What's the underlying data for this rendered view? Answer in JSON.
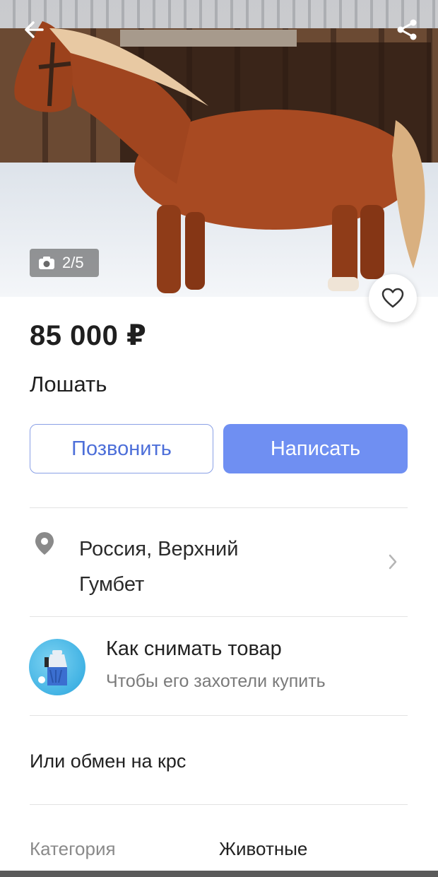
{
  "gallery": {
    "counter": "2/5",
    "icons": {
      "back": "arrow-left-icon",
      "share": "share-icon",
      "camera": "camera-icon",
      "favorite": "heart-icon"
    }
  },
  "listing": {
    "price": "85 000 ₽",
    "title": "Лошать"
  },
  "actions": {
    "call_label": "Позвонить",
    "write_label": "Написать"
  },
  "location": {
    "line1": "Россия, Верхний",
    "line2": "Гумбет"
  },
  "tip": {
    "title": "Как снимать товар",
    "subtitle": "Чтобы его захотели купить"
  },
  "description": "Или обмен на крс",
  "category": {
    "label": "Категория",
    "value": "Животные"
  },
  "colors": {
    "accent": "#6f8ff2",
    "accent_text": "#4d6fd9"
  }
}
